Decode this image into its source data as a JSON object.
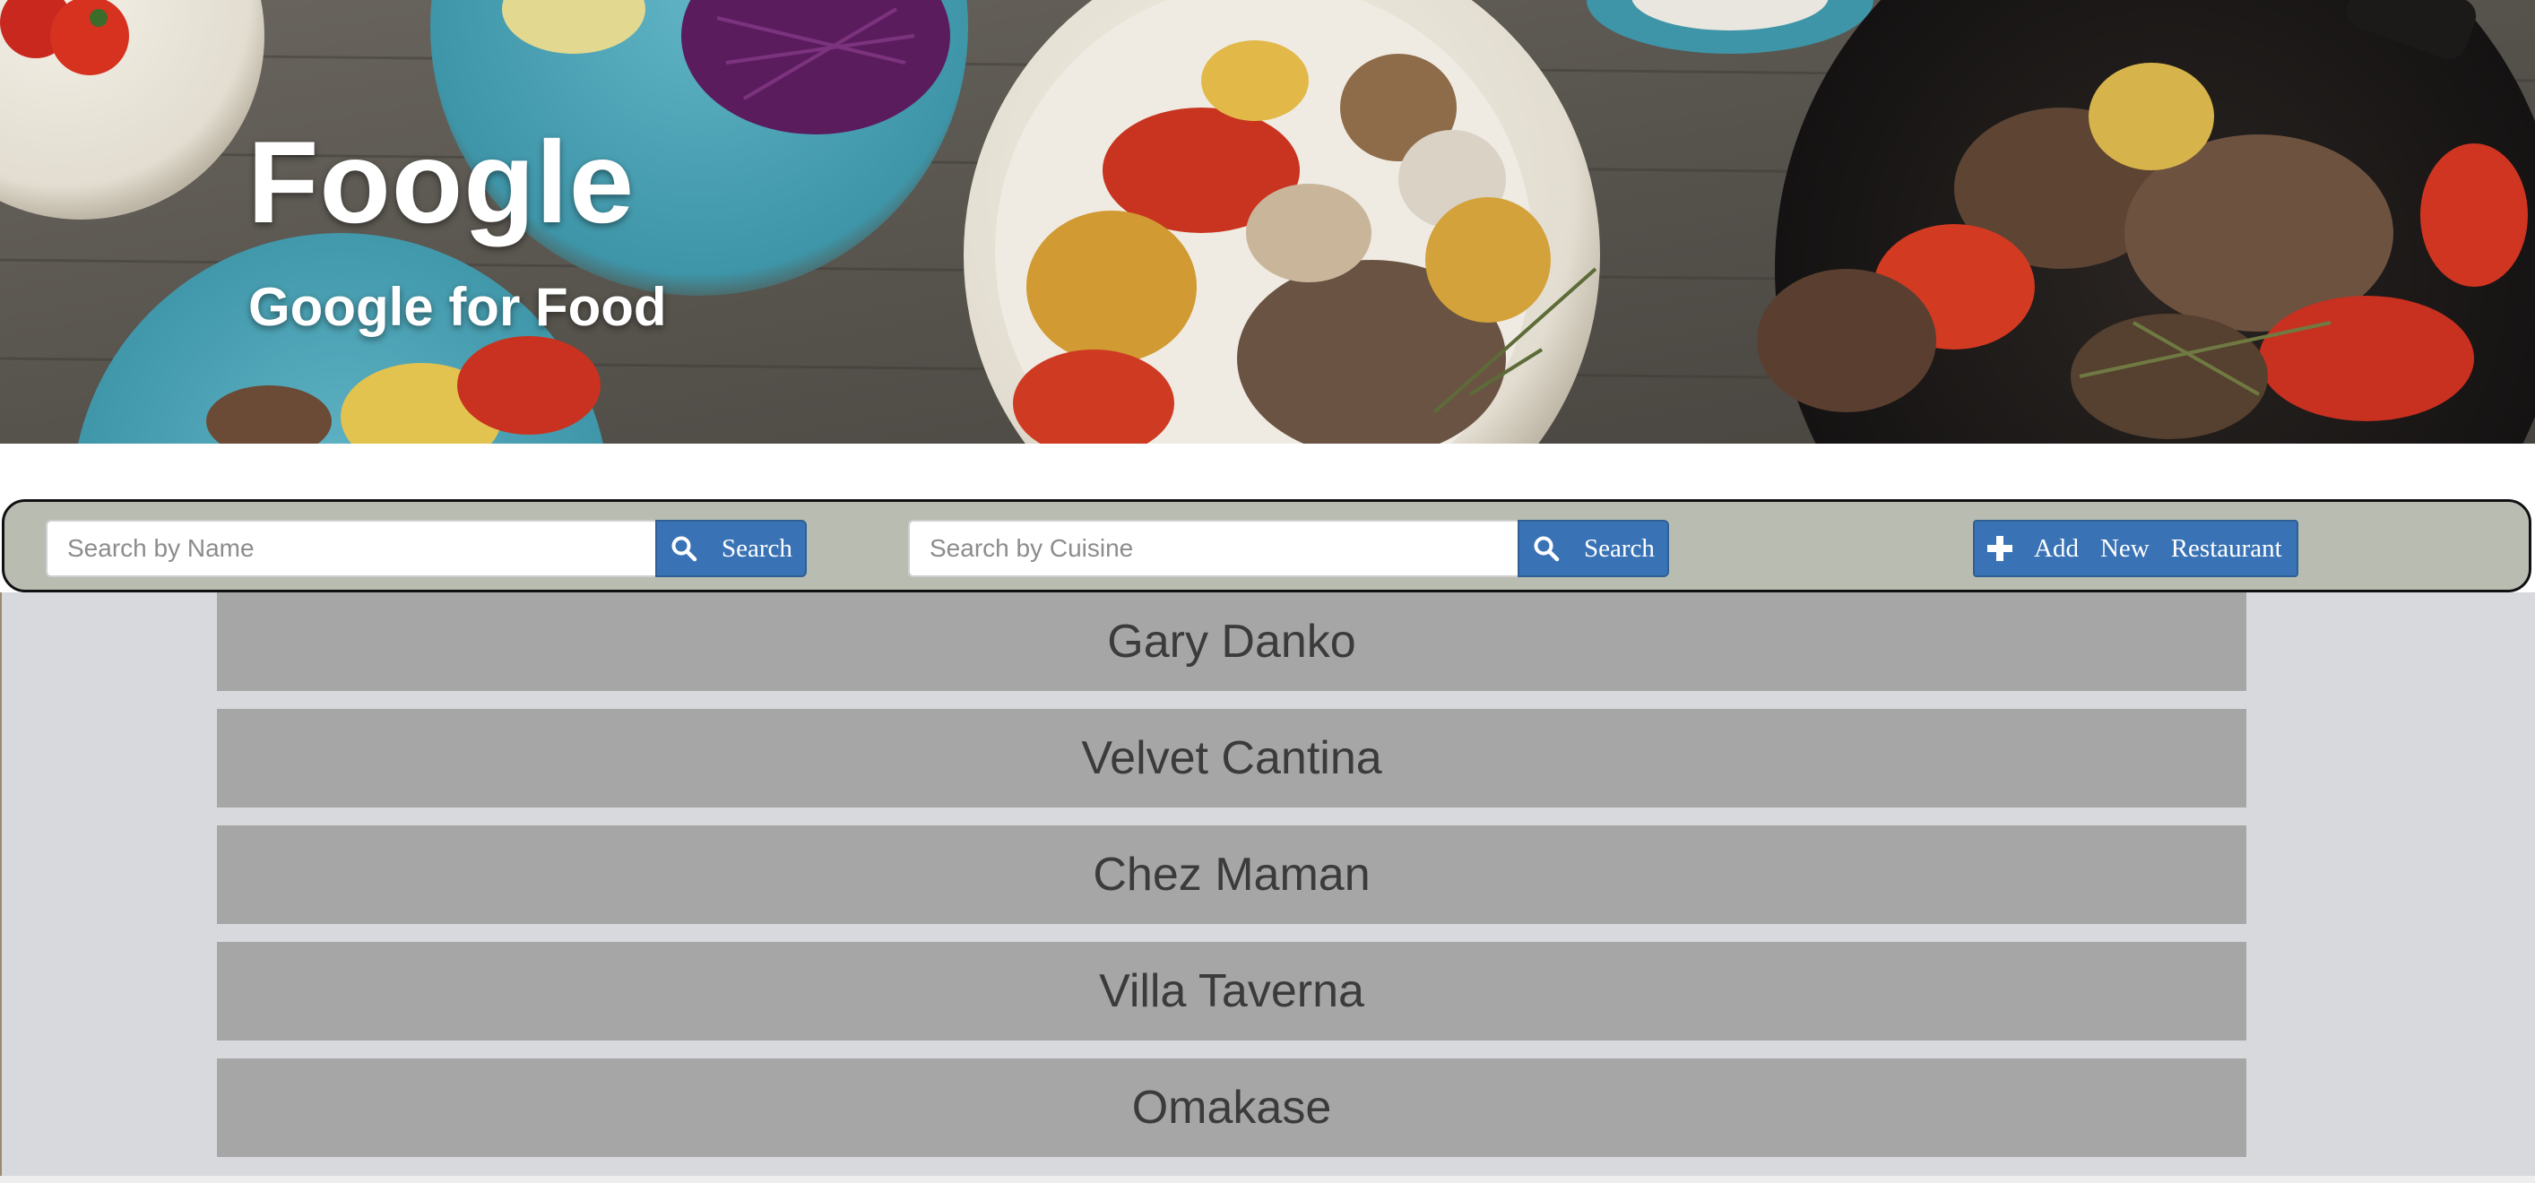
{
  "hero": {
    "title": "Foogle",
    "subtitle": "Google for Food"
  },
  "search_bar": {
    "name_search": {
      "placeholder": "Search by Name",
      "value": "",
      "button_label": "Search",
      "button_icon": "search-icon"
    },
    "cuisine_search": {
      "placeholder": "Search by Cuisine",
      "value": "",
      "button_label": "Search",
      "button_icon": "search-icon"
    },
    "add_button": {
      "icon": "plus-icon",
      "words": [
        "Add",
        "New",
        "Restaurant"
      ]
    }
  },
  "restaurants": [
    {
      "name": "Gary Danko"
    },
    {
      "name": "Velvet Cantina"
    },
    {
      "name": "Chez Maman"
    },
    {
      "name": "Villa Taverna"
    },
    {
      "name": "Omakase"
    }
  ],
  "colors": {
    "search_bar_bg": "#b9bdb1",
    "button_blue": "#3a73b5",
    "list_item_bg": "#a6a6a6",
    "list_area_bg": "#d8d9dd"
  }
}
